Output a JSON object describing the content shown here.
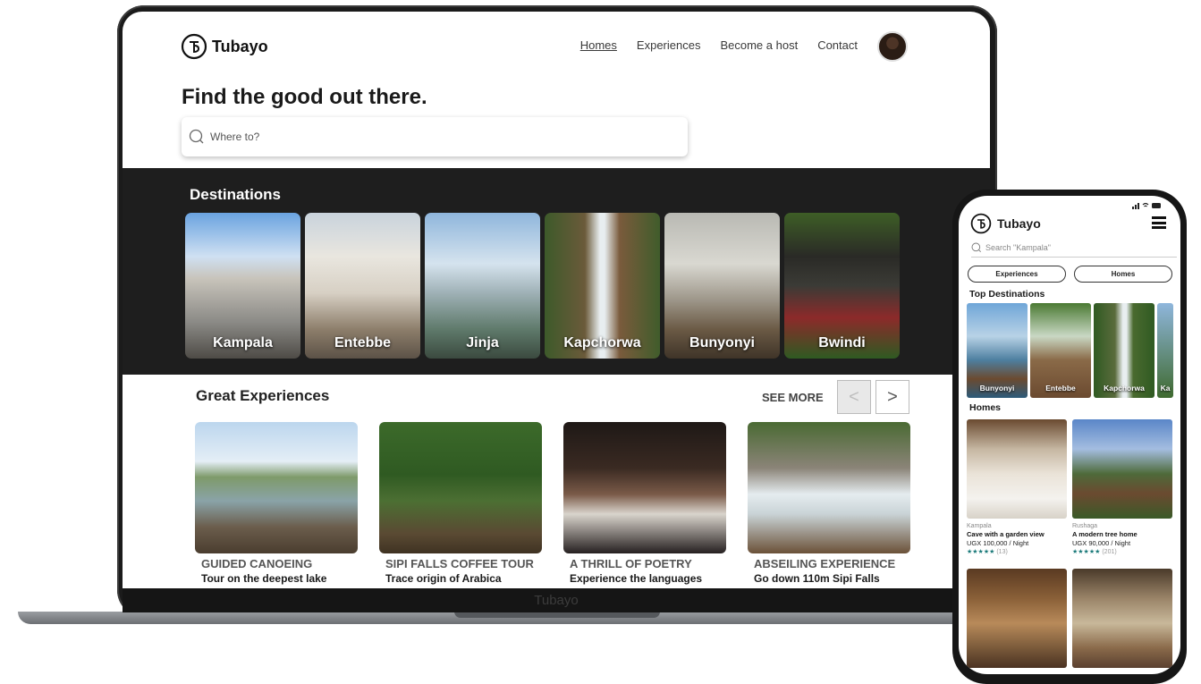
{
  "brand": "Tubayo",
  "nav": {
    "links": [
      "Homes",
      "Experiences",
      "Become a host",
      "Contact"
    ],
    "active": "Homes"
  },
  "hero": {
    "title": "Find the good out there.",
    "search_placeholder": "Where to?"
  },
  "destinations": {
    "title": "Destinations",
    "items": [
      "Kampala",
      "Entebbe",
      "Jinja",
      "Kapchorwa",
      "Bunyonyi",
      "Bwindi"
    ]
  },
  "experiences": {
    "title": "Great Experiences",
    "see_more": "SEE MORE",
    "prev_glyph": "<",
    "next_glyph": ">",
    "items": [
      {
        "name": "GUIDED CANOEING",
        "subtitle": "Tour on the deepest lake"
      },
      {
        "name": "SIPI FALLS COFFEE TOUR",
        "subtitle": "Trace origin of Arabica"
      },
      {
        "name": "A THRILL OF POETRY",
        "subtitle": "Experience the languages"
      },
      {
        "name": "ABSEILING EXPERIENCE",
        "subtitle": "Go down 110m Sipi Falls"
      }
    ]
  },
  "laptop_footer": "Tubayo",
  "mobile": {
    "brand": "Tubayo",
    "search_placeholder": "Search  \"Kampala\"",
    "tabs": [
      "Experiences",
      "Homes"
    ],
    "top_destinations_title": "Top Destinations",
    "top_destinations": [
      "Bunyonyi",
      "Entebbe",
      "Kapchorwa",
      "Ka"
    ],
    "homes_title": "Homes",
    "homes": [
      {
        "location": "Kampala",
        "name": "Cave with a garden view",
        "price": "UGX 100,000 / Night",
        "stars": "★★★★★",
        "reviews": "(13)"
      },
      {
        "location": "Rushaga",
        "name": "A modern tree home",
        "price": "UGX 90,000 / Night",
        "stars": "★★★★★",
        "reviews": "(201)"
      }
    ]
  },
  "colors": {
    "dark_band": "#1e1e1e",
    "rating": "#1b7a7a"
  }
}
